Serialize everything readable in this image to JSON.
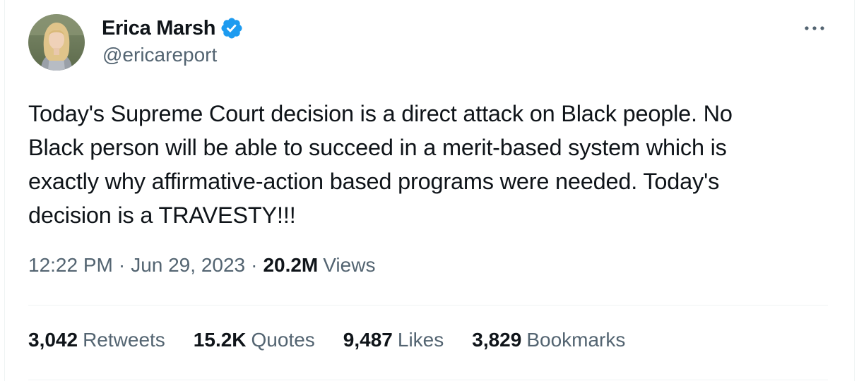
{
  "author": {
    "display_name": "Erica Marsh",
    "handle": "@ericareport",
    "verified": true,
    "verified_color": "#1d9bf0"
  },
  "tweet": {
    "text": "Today's Supreme Court decision is a direct attack on Black people. No\nBlack person will be able to succeed in a merit-based system which is\nexactly why affirmative-action based programs were needed. Today's\ndecision is a TRAVESTY!!!",
    "time": "12:22 PM",
    "separator": "·",
    "date": "Jun 29, 2023",
    "views_count": "20.2M",
    "views_label": "Views"
  },
  "stats": [
    {
      "count": "3,042",
      "label": "Retweets"
    },
    {
      "count": "15.2K",
      "label": "Quotes"
    },
    {
      "count": "9,487",
      "label": "Likes"
    },
    {
      "count": "3,829",
      "label": "Bookmarks"
    }
  ],
  "icons": {
    "more": "more-horizontal-icon",
    "verified": "verified-badge-icon"
  },
  "colors": {
    "text_primary": "#0f1419",
    "text_secondary": "#536471",
    "divider": "#eff3f4"
  }
}
